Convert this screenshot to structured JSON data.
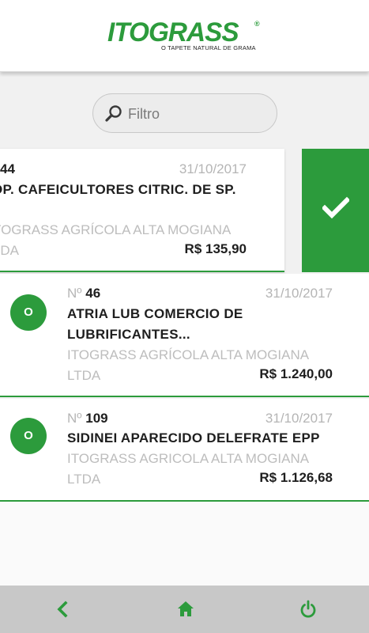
{
  "header": {
    "logo_text": "ITOGRASS",
    "logo_reg": "®",
    "logo_tagline": "O TAPETE NATURAL DE GRAMA"
  },
  "search": {
    "placeholder": "Filtro",
    "value": ""
  },
  "swipe_action": {
    "icon": "check-icon"
  },
  "orders": [
    {
      "number_prefix": "",
      "number": "44",
      "date": "31/10/2017",
      "client": "OP. CAFEICULTORES CITRIC. DE SP.",
      "company_line1": "TOGRASS AGRÍCOLA ALTA MOGIANA",
      "company_line2": "TDA",
      "amount": "R$ 135,90",
      "badge": ""
    },
    {
      "number_prefix": "Nº",
      "number": "46",
      "date": "31/10/2017",
      "client_line1": "ATRIA LUB COMERCIO DE",
      "client_line2": "LUBRIFICANTES...",
      "company_line1": "ITOGRASS AGRÍCOLA ALTA MOGIANA",
      "company_line2": "LTDA",
      "amount": "R$ 1.240,00",
      "badge": "O"
    },
    {
      "number_prefix": "Nº",
      "number": "109",
      "date": "31/10/2017",
      "client": "SIDINEI APARECIDO DELEFRATE EPP",
      "company_line1": "ITOGRASS AGRICOLA ALTA MOGIANA",
      "company_line2": "LTDA",
      "amount": "R$ 1.126,68",
      "badge": "O"
    }
  ],
  "bottom_nav": {
    "back_icon": "chevron-left-icon",
    "home_icon": "home-icon",
    "power_icon": "power-icon"
  },
  "colors": {
    "brand_green": "#2c9b3c",
    "nav_bg": "#c8c8c8"
  }
}
